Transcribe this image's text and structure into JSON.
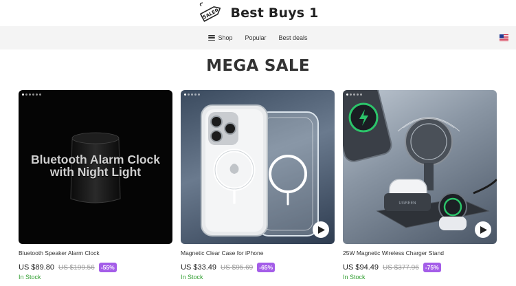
{
  "site": {
    "name": "Best Buys 1",
    "logo_text": "SALE",
    "logo_icon": "sale-tag-icon"
  },
  "nav": {
    "items": [
      {
        "label": "Shop",
        "icon": "menu-icon"
      },
      {
        "label": "Popular"
      },
      {
        "label": "Best deals"
      }
    ],
    "flag_icon": "us-flag-icon"
  },
  "page": {
    "heading": "MEGA SALE"
  },
  "colors": {
    "badge": "#a45de8",
    "in_stock": "#2e9d2e",
    "nav_bg": "#f4f4f4"
  },
  "products": [
    {
      "name": "Bluetooth Speaker Alarm Clock",
      "image_text": "Bluetooth Alarm Clock with Night Light",
      "price": "US $89.80",
      "old_price": "US $199.56",
      "discount": "-55%",
      "stock": "In Stock",
      "has_video": false
    },
    {
      "name": "Magnetic Clear Case for iPhone",
      "price": "US $33.49",
      "old_price": "US $95.69",
      "discount": "-65%",
      "stock": "In Stock",
      "has_video": true
    },
    {
      "name": "25W Magnetic Wireless Charger Stand",
      "price": "US $94.49",
      "old_price": "US $377.96",
      "discount": "-75%",
      "stock": "In Stock",
      "has_video": true
    }
  ]
}
